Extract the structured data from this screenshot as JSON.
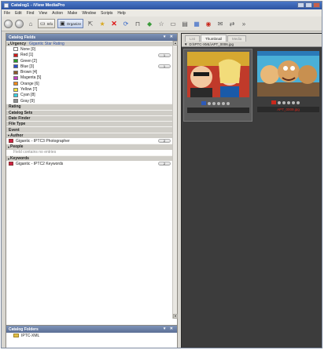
{
  "window": {
    "title": "Catalog1 - iView MediaPro"
  },
  "menu": [
    "File",
    "Edit",
    "Find",
    "View",
    "Action",
    "Make",
    "Window",
    "Scripts",
    "Help"
  ],
  "toolbar": {
    "info_label": "Info",
    "organize_label": "Organize"
  },
  "catalog_fields": {
    "title": "Catalog Fields",
    "urgency": {
      "label": "Urgency",
      "subset": "Gigantic Star Rating",
      "items": [
        {
          "label": "None [0]",
          "color": "#ffffff",
          "count": ""
        },
        {
          "label": "Red [1]",
          "color": "#d11a1a",
          "count": "1"
        },
        {
          "label": "Green [2]",
          "color": "#2a9a2a",
          "count": ""
        },
        {
          "label": "Blue [3]",
          "color": "#2a4fc8",
          "count": "1"
        },
        {
          "label": "Brown [4]",
          "color": "#8a5a2a",
          "count": ""
        },
        {
          "label": "Magenta [5]",
          "color": "#c03cc0",
          "count": ""
        },
        {
          "label": "Orange [6]",
          "color": "#f08a1a",
          "count": ""
        },
        {
          "label": "Yellow [7]",
          "color": "#f0e23a",
          "count": ""
        },
        {
          "label": "Cyan [8]",
          "color": "#3ad0e0",
          "count": ""
        },
        {
          "label": "Gray [9]",
          "color": "#909090",
          "count": ""
        }
      ]
    },
    "sections": [
      "Rating",
      "Catalog Sets",
      "Date Finder",
      "File Type",
      "Event"
    ],
    "author": {
      "label": "Author",
      "item": "Gigantic - IPTC3 Photographer",
      "count": "2"
    },
    "people": {
      "label": "People",
      "empty": "Field contains no entries"
    },
    "keywords": {
      "label": "Keywords",
      "item": "Gigantic - IPTC2 Keywords",
      "count": "2"
    }
  },
  "catalog_folders": {
    "title": "Catalog Folders",
    "item": "IPTC-XML"
  },
  "viewer": {
    "tabs": [
      "List",
      "Thumbnail",
      "Media"
    ],
    "active_tab": "Thumbnail",
    "path": "D:\\IPTC-XML\\APT_0006.jpg",
    "thumbs": [
      {
        "name": "thumb-1",
        "label": "",
        "label_color": "#c8c8c8"
      },
      {
        "name": "thumb-2",
        "label": "APT_0009.jpg",
        "label_color": "#d8281c"
      }
    ]
  }
}
